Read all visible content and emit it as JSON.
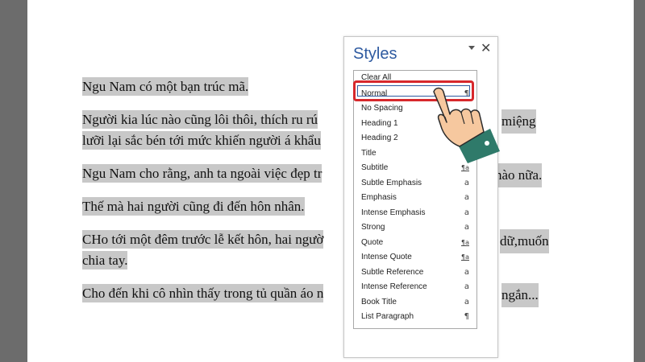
{
  "document": {
    "paragraphs": [
      [
        "Ngu Nam có một bạn trúc mã."
      ],
      [
        "Người kia lúc nào cũng lôi thôi, thích ru rú",
        "miệng",
        "lưỡi lại sắc bén tới mức khiến người á khẩu"
      ],
      [
        "Ngu Nam cho rằng, anh ta ngoài việc đẹp tr",
        "nào nữa."
      ],
      [
        "Thế mà hai người cũng đi đến hôn nhân."
      ],
      [
        "CHo tới một đêm trước lễ kết hôn, hai ngườ",
        "dữ,muốn",
        "chia tay."
      ],
      [
        "Cho đến khi cô nhìn thấy trong tủ quần áo n",
        "ngắn..."
      ]
    ]
  },
  "styles_pane": {
    "title": "Styles",
    "items": [
      {
        "label": "Clear All",
        "symbol": ""
      },
      {
        "label": "Normal",
        "symbol": "¶"
      },
      {
        "label": "No Spacing",
        "symbol": "¶"
      },
      {
        "label": "Heading 1",
        "symbol": "¶a"
      },
      {
        "label": "Heading 2",
        "symbol": "¶a"
      },
      {
        "label": "Title",
        "symbol": "¶a"
      },
      {
        "label": "Subtitle",
        "symbol": "¶a"
      },
      {
        "label": "Subtle Emphasis",
        "symbol": "a"
      },
      {
        "label": "Emphasis",
        "symbol": "a"
      },
      {
        "label": "Intense Emphasis",
        "symbol": "a"
      },
      {
        "label": "Strong",
        "symbol": "a"
      },
      {
        "label": "Quote",
        "symbol": "¶a"
      },
      {
        "label": "Intense Quote",
        "symbol": "¶a"
      },
      {
        "label": "Subtle Reference",
        "symbol": "a"
      },
      {
        "label": "Intense Reference",
        "symbol": "a"
      },
      {
        "label": "Book Title",
        "symbol": "a"
      },
      {
        "label": "List Paragraph",
        "symbol": "¶"
      }
    ],
    "selected": "Normal",
    "highlight_color": "#d7282c",
    "title_color": "#2e5aa0"
  }
}
